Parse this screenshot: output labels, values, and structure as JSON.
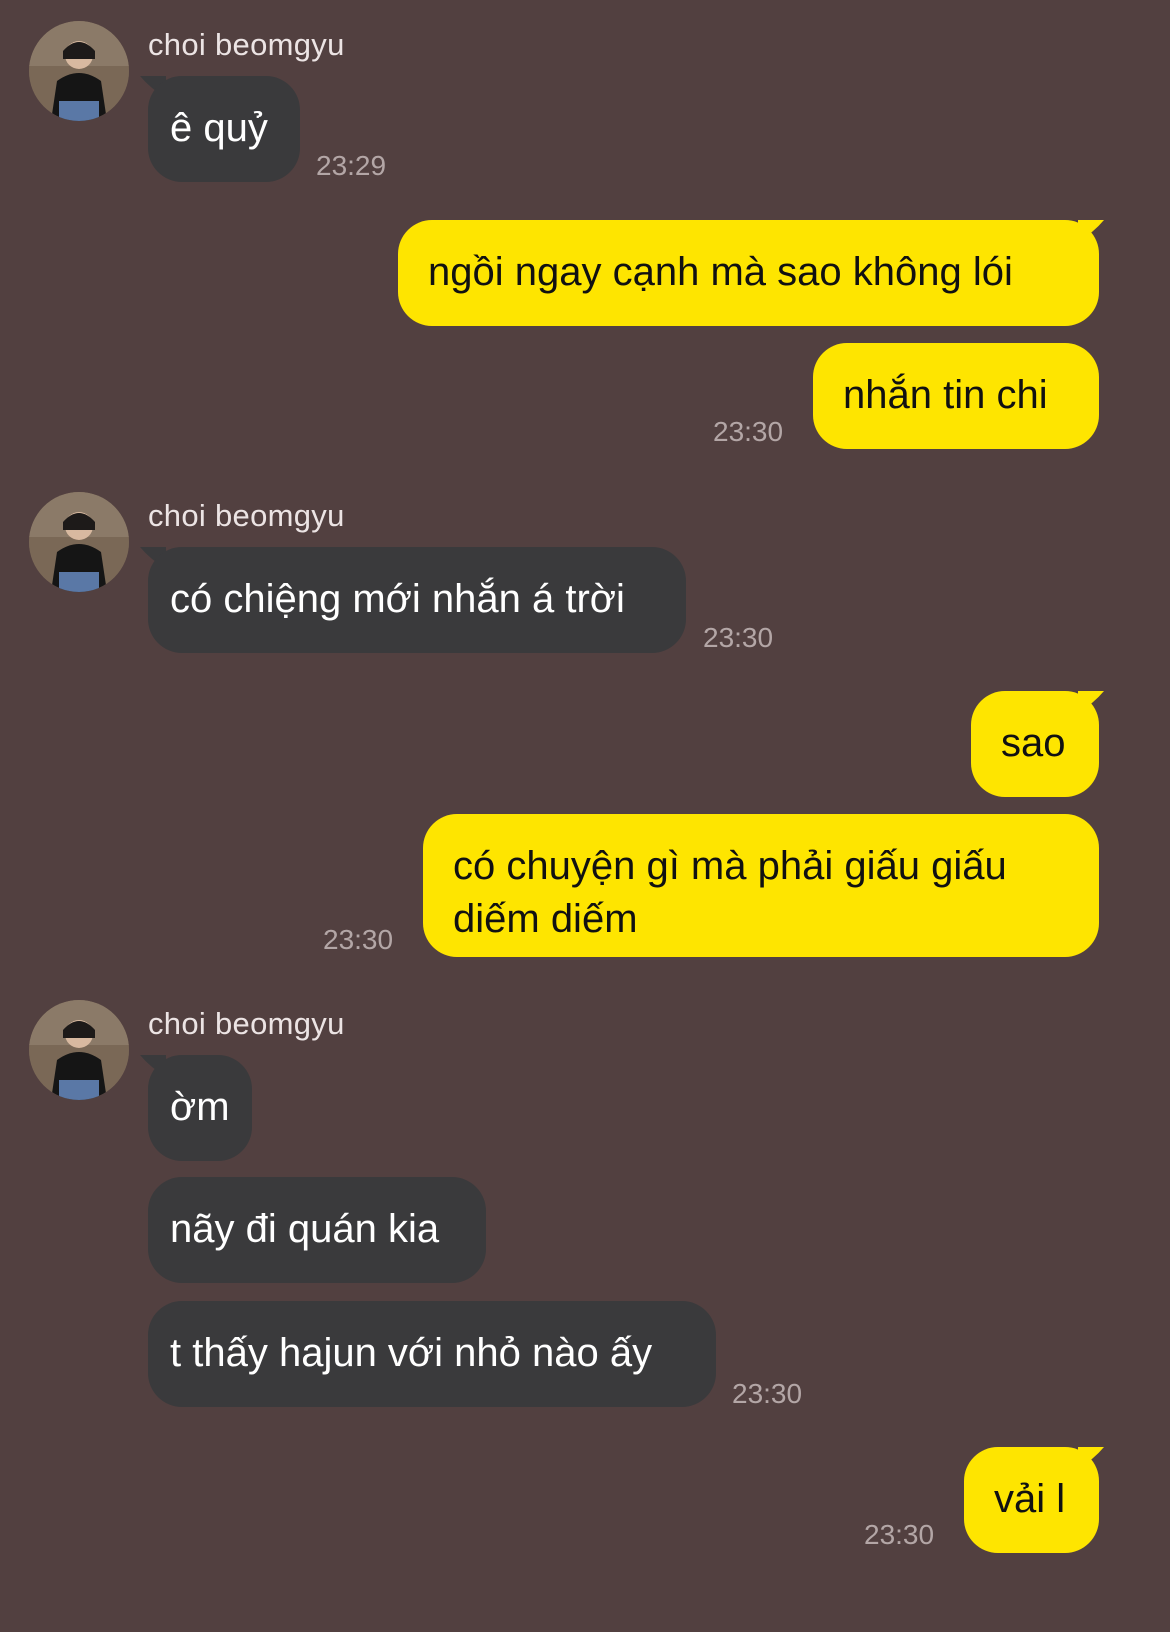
{
  "contact": {
    "name": "choi beomgyu"
  },
  "colors": {
    "background": "#524040",
    "incoming_bubble": "#3a3a3c",
    "outgoing_bubble": "#fee500",
    "timestamp": "#b3a6a6"
  },
  "messages": [
    {
      "direction": "incoming",
      "sender": "choi beomgyu",
      "text": "ê quỷ",
      "time": "23:29"
    },
    {
      "direction": "outgoing",
      "text": "ngồi ngay cạnh mà sao không lói",
      "time": ""
    },
    {
      "direction": "outgoing",
      "text": "nhắn tin chi",
      "time": "23:30"
    },
    {
      "direction": "incoming",
      "sender": "choi beomgyu",
      "text": "có chiệng mới nhắn á trời",
      "time": "23:30"
    },
    {
      "direction": "outgoing",
      "text": "sao",
      "time": ""
    },
    {
      "direction": "outgoing",
      "text": "có chuyện gì mà phải giấu giấu diếm diếm",
      "time": "23:30"
    },
    {
      "direction": "incoming",
      "sender": "choi beomgyu",
      "text": "ờm",
      "time": ""
    },
    {
      "direction": "incoming",
      "text": "nãy đi quán kia",
      "time": ""
    },
    {
      "direction": "incoming",
      "text": "t thấy hajun với nhỏ nào ấy",
      "time": "23:30"
    },
    {
      "direction": "outgoing",
      "text": "vải l",
      "time": "23:30"
    }
  ]
}
